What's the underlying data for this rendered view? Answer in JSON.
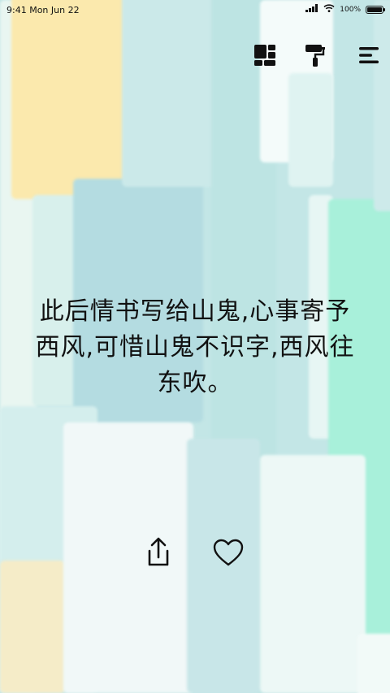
{
  "status_bar": {
    "time": "9:41",
    "date": "Mon Jun 22",
    "battery_text": "100%",
    "battery_level": 1.0
  },
  "toolbar": {
    "layout_icon": "layout-grid-icon",
    "theme_icon": "paint-roller-icon",
    "menu_icon": "menu-icon"
  },
  "quote": {
    "text": "此后情书写给山鬼,心事寄予西风,可惜山鬼不识字,西风往东吹。"
  },
  "actions": {
    "share_icon": "share-icon",
    "like_icon": "heart-icon"
  },
  "colors": {
    "background": "#bfe4e2",
    "text": "#111111",
    "accent_yellow": "#fbe7a6",
    "accent_mint": "#a6f0d8"
  }
}
